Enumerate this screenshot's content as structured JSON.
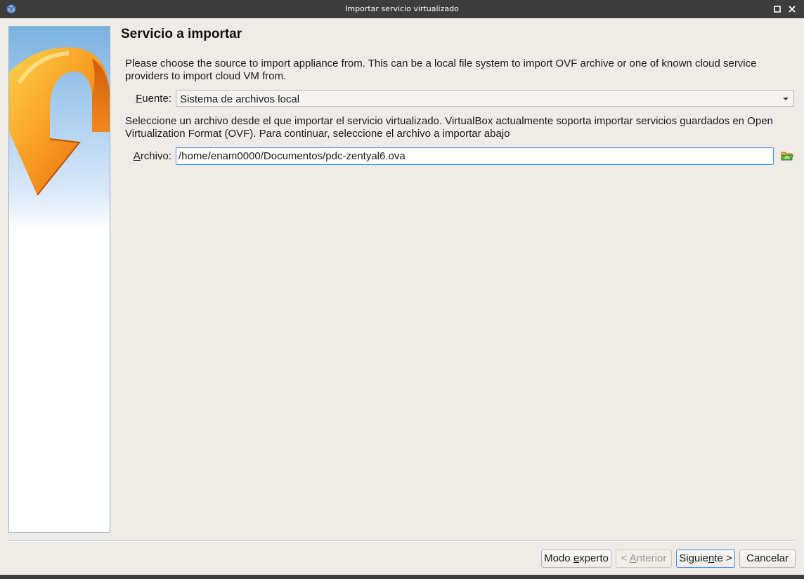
{
  "window": {
    "title": "Importar servicio virtualizado"
  },
  "page": {
    "title": "Servicio a importar",
    "description_source": "Please choose the source to import appliance from. This can be a local file system to import OVF archive or one of known cloud service providers to import cloud VM from.",
    "description_file": "Seleccione un archivo desde el que importar el servicio virtualizado. VirtualBox actualmente soporta importar servicios guardados en Open Virtualization Format (OVF). Para continuar, seleccione el archivo a importar abajo"
  },
  "source": {
    "label_mnemonic": "F",
    "label_rest": "uente:",
    "selected": "Sistema de archivos local"
  },
  "file": {
    "label_mnemonic": "A",
    "label_rest": "rchivo:",
    "value": "/home/enam0000/Documentos/pdc-zentyal6.ova"
  },
  "buttons": {
    "expert": {
      "pre": "Modo ",
      "mnemonic": "e",
      "post": "xperto"
    },
    "back": {
      "pre": "< ",
      "mnemonic": "A",
      "post": "nterior"
    },
    "next": {
      "pre": "Siguie",
      "mnemonic": "n",
      "post": "te >"
    },
    "cancel": {
      "label": "Cancelar"
    }
  },
  "icons": {
    "app": "virtualbox-icon",
    "maximize": "maximize-icon",
    "close": "close-icon",
    "dropdown": "chevron-down-icon",
    "folder": "folder-open-icon",
    "banner": "import-arrow-icon"
  },
  "colors": {
    "titlebar": "#3d3d3d",
    "background": "#efebe7",
    "focus_border": "#3d8ee0",
    "arrow_orange": "#f28a1e"
  }
}
